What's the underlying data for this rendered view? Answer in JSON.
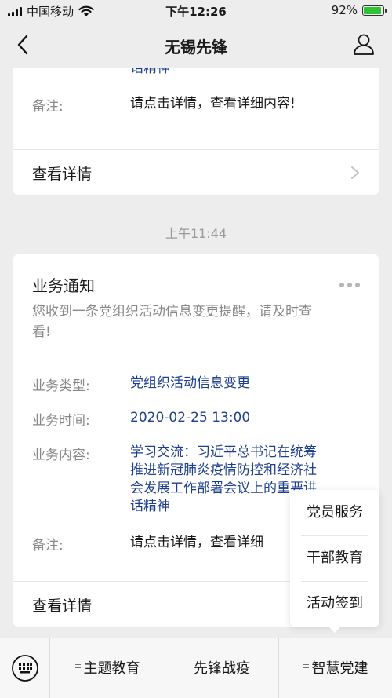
{
  "status_bar": {
    "carrier": "中国移动",
    "time": "下午12:26",
    "battery_percent_text": "92%",
    "battery_level": 0.92,
    "battery_color": "#2ec234"
  },
  "nav": {
    "title": "无锡先锋",
    "back_icon": "chevron-left-icon",
    "user_icon": "user-icon"
  },
  "card_prev": {
    "content_tail": "话精神",
    "note_label": "备注:",
    "note_value": "请点击详情，查看详细内容!",
    "footer_label": "查看详情"
  },
  "time_separator": "上午11:44",
  "card_main": {
    "title": "业务通知",
    "description": "您收到一条党组织活动信息变更提醒，请及时查看!",
    "fields": [
      {
        "label": "业务类型:",
        "value": "党组织活动信息变更"
      },
      {
        "label": "业务时间:",
        "value": "2020-02-25 13:00"
      },
      {
        "label": "业务内容:",
        "value_lines": [
          "学习交流：习近平总书记在统筹",
          "推进新冠肺炎疫情防控和经济社",
          "会发展工作部署会议上的重要讲",
          "话精神"
        ]
      },
      {
        "label": "备注:",
        "value": "请点击详情，查看详细"
      }
    ],
    "footer_label": "查看详情"
  },
  "popup_menu": {
    "items": [
      "党员服务",
      "干部教育",
      "活动签到"
    ]
  },
  "bottom_menu": {
    "keyboard_icon": "keyboard-icon",
    "tabs": [
      "主题教育",
      "先锋战疫",
      "智慧党建"
    ]
  },
  "colors": {
    "link_blue": "#1e3f8f",
    "background": "#ededed"
  }
}
